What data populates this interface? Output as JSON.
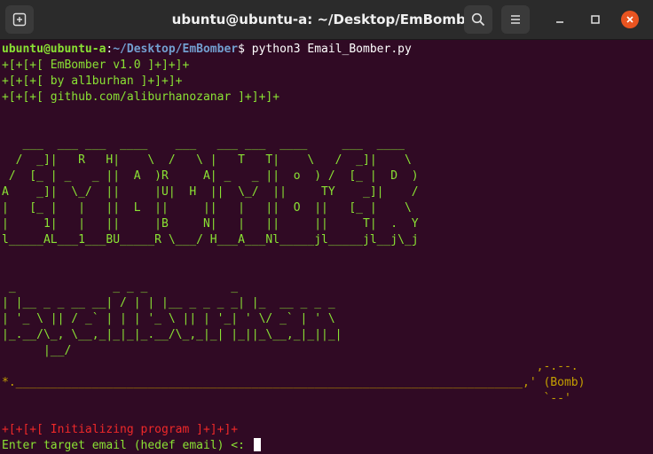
{
  "titlebar": {
    "title": "ubuntu@ubuntu-a: ~/Desktop/EmBomber",
    "new_tab_icon": "new-tab-icon",
    "search_icon": "search-icon",
    "menu_icon": "hamburger-menu-icon",
    "minimize_icon": "minimize-icon",
    "maximize_icon": "maximize-icon",
    "close_icon": "close-icon"
  },
  "prompt": {
    "user_host": "ubuntu@ubuntu-a",
    "separator": ":",
    "path": "~/Desktop/EmBomber",
    "symbol": "$",
    "command": " python3 Email_Bomber.py"
  },
  "header_lines": [
    "+[+[+[ EmBomber v1.0 ]+]+]+",
    "+[+[+[ by al1burhan ]+]+]+",
    "+[+[+[ github.com/aliburhanozanar ]+]+]+"
  ],
  "banner_lines": [
    "",
    "",
    "   ___  ___ ___  ____    ___   ___ ___  ____     ___  ____",
    "  /  _]|   R   H|    \\  /   \\ |   T   T|    \\   /  _]|    \\",
    " /  [_ | _   _ ||  A  )R     A| _   _ ||  o  ) /  [_ |  D  )",
    "A    _]|  \\_/  ||     |U|  H  ||  \\_/  ||     TY    _]|    /",
    "|   [_ |   |   ||  L  ||     ||   |   ||  O  ||   [_ |    \\",
    "|     1|   |   ||     |B     N|   |   ||     ||     T|  .  Y",
    "l_____AL___1___BU_____R \\___/ H___A___Nl_____jl_____jl__j\\_j",
    "",
    "",
    " _              _ _ _            _",
    "| |__ _ _ __ __| / | | |__ _ _ _ _| |_  __ _ _ _",
    "| '_ \\ || / _` | | | '_ \\ || | '_| ' \\/ _` | ' \\",
    "|_.__/\\_, \\__,_|_|_|_.__/\\_,_|_| |_||_\\__,_|_||_|",
    "      |__/"
  ],
  "bomb_lines": [
    "                                                                             ,-.--.",
    "*._________________________________________________________________________,' (Bomb)",
    "                                                                              `--'"
  ],
  "status_line": "+[+[+[ Initializing program ]+]+]+",
  "input_line": {
    "label": "Enter target email (hedef email) <: ",
    "value": ""
  },
  "colors": {
    "terminal_bg": "#300a24",
    "titlebar_bg": "#2b2b2b",
    "green": "#8ae234",
    "yellow": "#c4a000",
    "red": "#ef2929",
    "path_blue": "#729fcf",
    "close_button": "#e95420"
  }
}
